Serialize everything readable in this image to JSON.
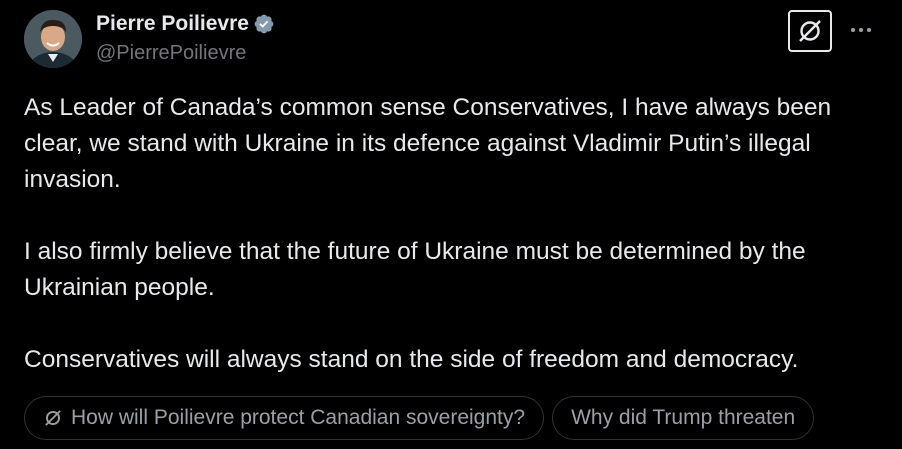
{
  "author": {
    "name": "Pierre Poilievre",
    "handle": "@PierrePoilievre",
    "verified": true,
    "verified_color": "#829aab"
  },
  "tweet": {
    "paragraphs": [
      "As Leader of Canada’s common sense Conservatives, I have always been clear, we stand with Ukraine in its defence against Vladimir Putin’s illegal invasion.",
      "I also firmly believe that the future of Ukraine must be determined by the Ukrainian people.",
      "Conservatives will always stand on the side of freedom and democracy."
    ]
  },
  "actions": {
    "grok_icon": "grok-icon",
    "more_icon": "more-horizontal-icon"
  },
  "suggestions": [
    {
      "label": "How will Poilievre protect Canadian sovereignty?",
      "icon": "grok-icon"
    },
    {
      "label": "Why did Trump threaten"
    }
  ],
  "colors": {
    "background": "#000000",
    "text": "#e7e9ea",
    "secondary": "#71767b",
    "chip_border": "#2f3336"
  }
}
